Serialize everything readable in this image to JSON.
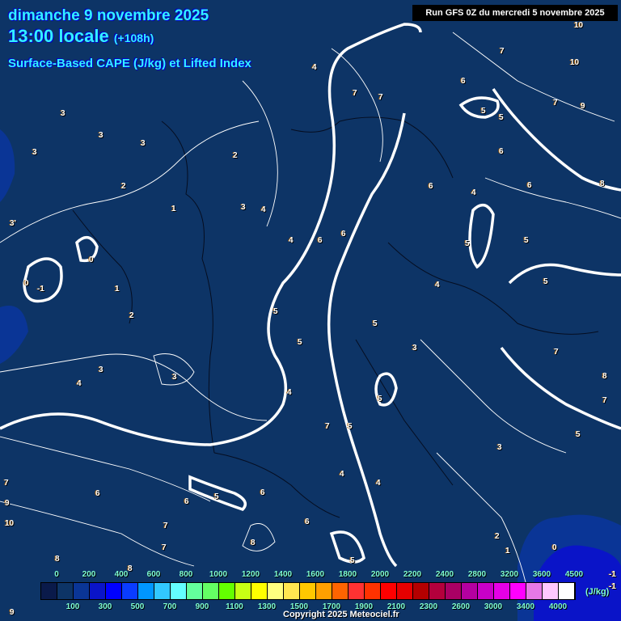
{
  "header": {
    "date": "dimanche 9 novembre 2025",
    "time": "13:00 locale",
    "lead": "(+108h)",
    "product": "Surface-Based CAPE (J/kg) et Lifted Index"
  },
  "run": "Run GFS 0Z du mercredi 5 novembre 2025",
  "map": {
    "labels": [
      "3",
      "3",
      "3",
      "3",
      "2",
      "1",
      "3'",
      "0",
      "-1",
      "0",
      "1",
      "2",
      "4",
      "3",
      "3",
      "2",
      "4",
      "3",
      "4",
      "4",
      "6",
      "6",
      "5",
      "5",
      "5",
      "5",
      "4",
      "3",
      "7",
      "5",
      "7",
      "4",
      "6",
      "5",
      "6",
      "7",
      "6",
      "7",
      "6",
      "5",
      "5",
      "4",
      "6",
      "6",
      "5",
      "5",
      "5",
      "4",
      "7",
      "8",
      "7",
      "9",
      "10",
      "7",
      "10",
      "6",
      "6",
      "7",
      "4",
      "5",
      "8",
      "8",
      "7",
      "9",
      "10",
      "8",
      "5",
      "3",
      "2",
      "1",
      "0",
      "-1",
      "-1",
      "8",
      "7",
      "9"
    ]
  },
  "colorbar": {
    "unit": "(J/kg)",
    "top_labels": [
      "0",
      "200",
      "400",
      "600",
      "800",
      "1000",
      "1200",
      "1400",
      "1600",
      "1800",
      "2000",
      "2200",
      "2400",
      "2800",
      "3200",
      "3600",
      "4500"
    ],
    "bottom_labels": [
      "100",
      "300",
      "500",
      "700",
      "900",
      "1100",
      "1300",
      "1500",
      "1700",
      "1900",
      "2100",
      "2300",
      "2600",
      "3000",
      "3400",
      "4000"
    ],
    "colors": [
      "#0a1a4a",
      "#0d3466",
      "#0a3596",
      "#0a14c8",
      "#0000ff",
      "#0a3cff",
      "#0096ff",
      "#32c8ff",
      "#64ffff",
      "#64ff9c",
      "#64ff64",
      "#64ff00",
      "#c8ff14",
      "#ffff00",
      "#ffff80",
      "#ffe650",
      "#ffc800",
      "#ffa000",
      "#ff6400",
      "#ff3232",
      "#ff3200",
      "#ff0000",
      "#e60000",
      "#b40000",
      "#b4003c",
      "#aa0064",
      "#b400a0",
      "#c800c8",
      "#e600e6",
      "#ff00ff",
      "#e678e6",
      "#ffc8ff",
      "#ffffff"
    ]
  },
  "copyright": "Copyright 2025 Meteociel.fr"
}
